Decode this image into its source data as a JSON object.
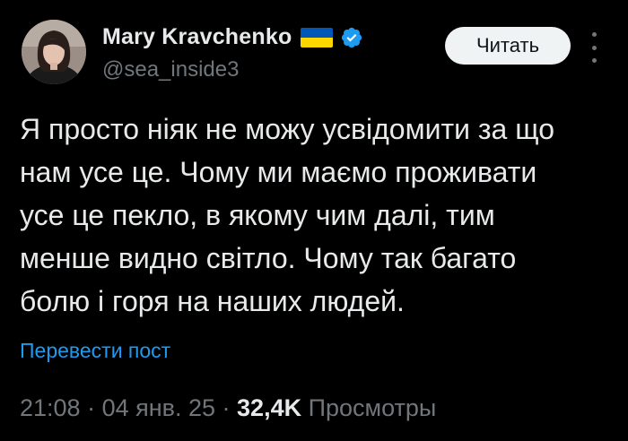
{
  "author": {
    "display_name": "Mary Kravchenko",
    "handle": "@sea_inside3",
    "flag_icon": "ukraine-flag-icon",
    "verified_icon": "verified-badge-icon",
    "verified_color": "#1d9bf0"
  },
  "follow_button": {
    "label": "Читать"
  },
  "more_menu": {
    "icon": "more-vertical-icon"
  },
  "tweet": {
    "lines": [
      "Я просто ніяк не можу усвідомити за що",
      "нам усе це. Чому ми маємо проживати",
      "усе це пекло, в якому чим далі, тим",
      "менше видно світло. Чому так багато",
      "болю і горя на наших людей."
    ]
  },
  "translate_link": {
    "label": "Перевести пост"
  },
  "meta": {
    "time": "21:08",
    "separator": " · ",
    "date": "04 янв. 25",
    "views_count": "32,4K",
    "views_label": " Просмотры"
  },
  "colors": {
    "background": "#000000",
    "text": "#e7e9ea",
    "secondary": "#71767b",
    "link": "#1d9bf0",
    "button_bg": "#eff3f4"
  }
}
